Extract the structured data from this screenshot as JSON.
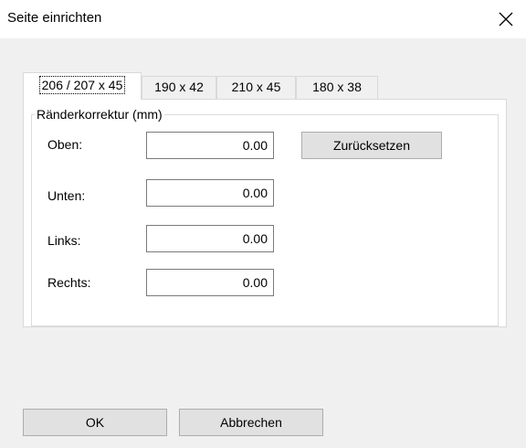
{
  "window": {
    "title": "Seite einrichten"
  },
  "tabs": [
    {
      "label": "206 / 207 x 45",
      "active": true
    },
    {
      "label": "190 x 42",
      "active": false
    },
    {
      "label": "210 x 45",
      "active": false
    },
    {
      "label": "180 x 38",
      "active": false
    }
  ],
  "margins": {
    "group_label": "Ränderkorrektur (mm)",
    "fields": [
      {
        "label": "Oben:",
        "value": "0.00"
      },
      {
        "label": "Unten:",
        "value": "0.00"
      },
      {
        "label": "Links:",
        "value": "0.00"
      },
      {
        "label": "Rechts:",
        "value": "0.00"
      }
    ],
    "reset_label": "Zurücksetzen"
  },
  "footer": {
    "ok_label": "OK",
    "cancel_label": "Abbrechen"
  },
  "icons": {
    "close": "close-icon"
  }
}
